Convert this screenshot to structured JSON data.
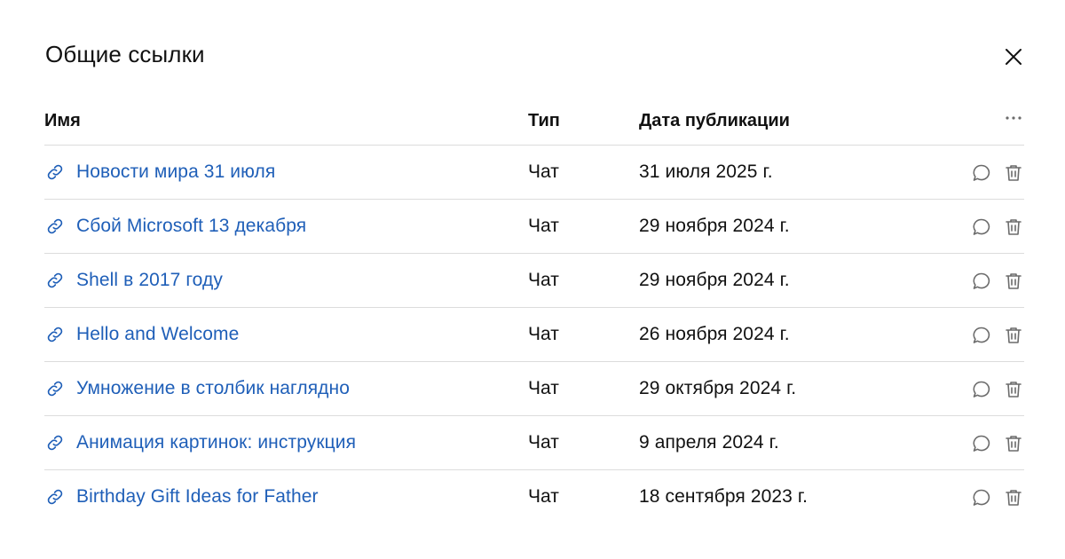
{
  "dialog": {
    "title": "Общие ссылки"
  },
  "table": {
    "headers": {
      "name": "Имя",
      "type": "Тип",
      "date": "Дата публикации"
    },
    "rows": [
      {
        "name": "Новости мира 31 июля",
        "type": "Чат",
        "date": "31 июля 2025 г."
      },
      {
        "name": "Сбой Microsoft 13 декабря",
        "type": "Чат",
        "date": "29 ноября 2024 г."
      },
      {
        "name": "Shell в 2017 году",
        "type": "Чат",
        "date": "29 ноября 2024 г."
      },
      {
        "name": "Hello and Welcome",
        "type": "Чат",
        "date": "26 ноября 2024 г."
      },
      {
        "name": "Умножение в столбик наглядно",
        "type": "Чат",
        "date": "29 октября 2024 г."
      },
      {
        "name": "Анимация картинок: инструкция",
        "type": "Чат",
        "date": "9 апреля 2024 г."
      },
      {
        "name": "Birthday Gift Ideas for Father",
        "type": "Чат",
        "date": "18 сентября 2023 г."
      }
    ]
  },
  "icons": {
    "link": "link-icon",
    "chat": "chat-bubble-icon",
    "delete": "trash-icon",
    "close": "close-icon",
    "more": "more-horizontal-icon"
  },
  "colors": {
    "link": "#1f5fb8",
    "text": "#111111",
    "divider": "#dcdcdc",
    "icon": "#6b6b6b"
  }
}
